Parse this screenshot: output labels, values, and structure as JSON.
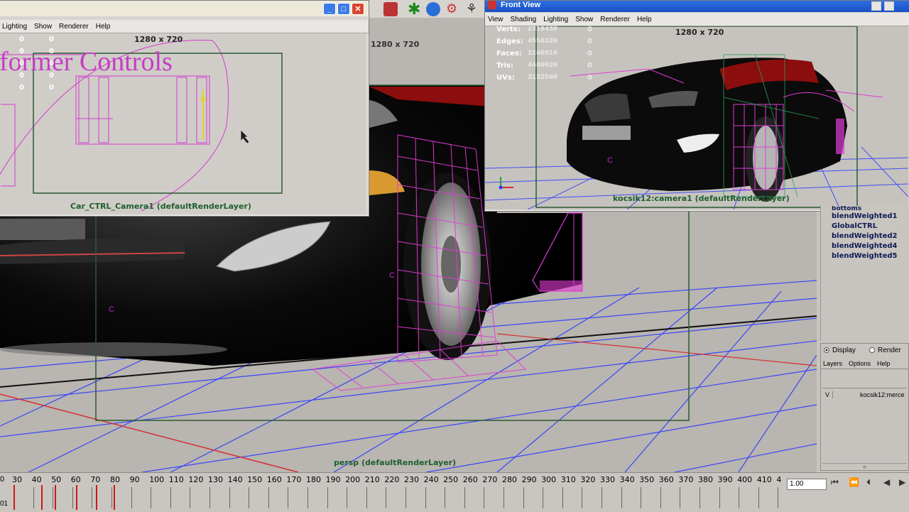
{
  "main_viewport": {
    "camera_label": "persp (defaultRenderLayer)",
    "pivot_markers": [
      "C",
      "C"
    ]
  },
  "camera_window": {
    "menu": [
      "Lighting",
      "Show",
      "Renderer",
      "Help"
    ],
    "resolution": "1280 x 720",
    "heading_text": "former Controls",
    "stat_zeros": [
      "0",
      "0",
      "0",
      "0",
      "0",
      "0",
      "0",
      "0",
      "0",
      "0"
    ],
    "camera_label": "Car_CTRL_Camera1 (defaultRenderLayer)",
    "buttons": [
      "minimize-icon",
      "maximize-icon",
      "close-icon"
    ]
  },
  "main_resolution": "1280 x 720",
  "front_view": {
    "title": "Front View",
    "menu": [
      "View",
      "Shading",
      "Lighting",
      "Show",
      "Renderer",
      "Help"
    ],
    "resolution": "1280 x 720",
    "stats": [
      {
        "label": "Verts:",
        "value": "2318430",
        "zero": "0"
      },
      {
        "label": "Edges:",
        "value": "4556320",
        "zero": "0"
      },
      {
        "label": "Faces:",
        "value": "2240010",
        "zero": "0"
      },
      {
        "label": "Tris:",
        "value": "4480020",
        "zero": "0"
      },
      {
        "label": "UVs:",
        "value": "3132500",
        "zero": "0"
      }
    ],
    "pivot_marker": "C",
    "camera_label": "kocsik12:camera1 (defaultRenderLayer)"
  },
  "outliner": {
    "cut_header": "bottoms",
    "items": [
      "blendWeighted1",
      "GlobalCTRL",
      "blendWeighted2",
      "blendWeighted4",
      "blendWeighted5"
    ]
  },
  "layer_editor": {
    "tabs": [
      {
        "label": "Display",
        "selected": true
      },
      {
        "label": "Render",
        "selected": false
      }
    ],
    "menu": [
      "Layers",
      "Options",
      "Help"
    ],
    "layer": {
      "visibility": "V",
      "name": "kocsik12:merce"
    },
    "collapse_glyph": "«"
  },
  "timeline": {
    "ticks": [
      "30",
      "40",
      "50",
      "60",
      "70",
      "80",
      "90",
      "100",
      "110",
      "120",
      "130",
      "140",
      "150",
      "160",
      "170",
      "180",
      "190",
      "200",
      "210",
      "220",
      "230",
      "240",
      "250",
      "260",
      "270",
      "280",
      "290",
      "300",
      "310",
      "320",
      "330",
      "340",
      "350",
      "360",
      "370",
      "380",
      "390",
      "400",
      "410",
      "4"
    ],
    "first_tick": "0",
    "current_frame": "1.00",
    "range_start": "01",
    "key_frames": [
      30,
      44,
      51,
      62,
      72,
      81
    ]
  },
  "playback_icons": [
    "rewind-to-start-icon",
    "step-back-key-icon",
    "step-back-icon",
    "play-backward-icon",
    "play-forward-icon"
  ],
  "colors": {
    "wire_magenta": "#e23ad6",
    "grid_blue": "#2b3bff",
    "axis_red": "#d43030",
    "camera_frame_green": "#2a5a31",
    "outliner_text": "#0c1a55"
  }
}
